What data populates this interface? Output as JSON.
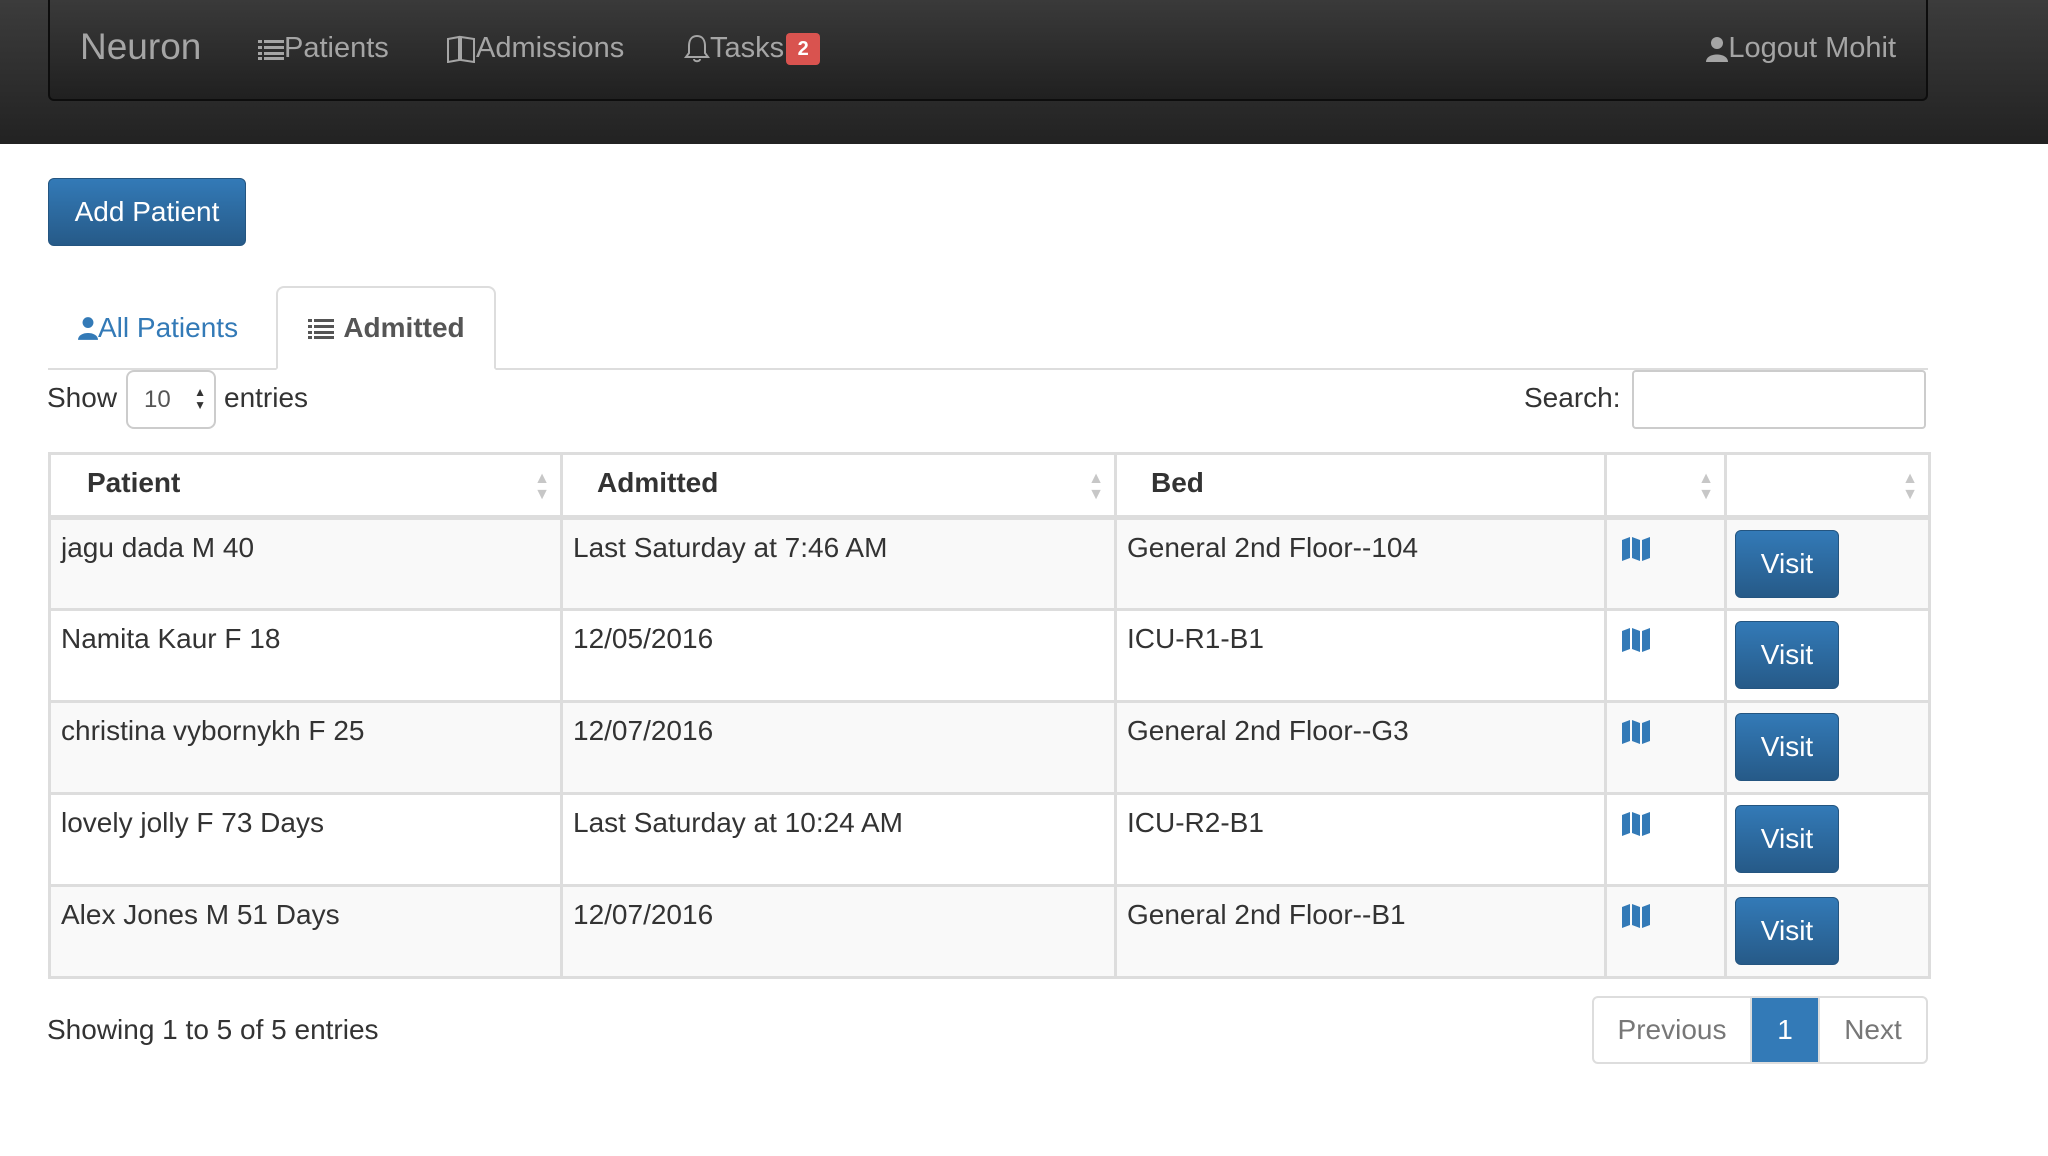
{
  "navbar": {
    "brand": "Neuron",
    "patients": "Patients",
    "admissions": "Admissions",
    "tasks": "Tasks",
    "tasks_badge": "2",
    "logout": "Logout Mohit"
  },
  "toolbar": {
    "add_patient": "Add Patient"
  },
  "tabs": {
    "all_patients": "All Patients",
    "admitted": "Admitted"
  },
  "length": {
    "show": "Show",
    "value": "10",
    "entries": "entries"
  },
  "search": {
    "label": "Search:",
    "value": ""
  },
  "table": {
    "headers": [
      "Patient",
      "Admitted",
      "Bed",
      "",
      ""
    ],
    "rows": [
      {
        "patient": "jagu dada M 40",
        "admitted": "Last Saturday at 7:46 AM",
        "bed": "General 2nd Floor--104",
        "action": "Visit"
      },
      {
        "patient": "Namita Kaur F 18",
        "admitted": "12/05/2016",
        "bed": "ICU-R1-B1",
        "action": "Visit"
      },
      {
        "patient": "christina vybornykh F 25",
        "admitted": "12/07/2016",
        "bed": "General 2nd Floor--G3",
        "action": "Visit"
      },
      {
        "patient": "lovely jolly F 73 Days",
        "admitted": "Last Saturday at 10:24 AM",
        "bed": "ICU-R2-B1",
        "action": "Visit"
      },
      {
        "patient": "Alex Jones M 51 Days",
        "admitted": "12/07/2016",
        "bed": "General 2nd Floor--B1",
        "action": "Visit"
      }
    ]
  },
  "footer": {
    "info": "Showing 1 to 5 of 5 entries",
    "previous": "Previous",
    "current_page": "1",
    "next": "Next"
  },
  "icons": {
    "patients": "list-icon",
    "admissions": "book-icon",
    "tasks": "bell-icon",
    "logout": "user-icon",
    "all_patients": "user-icon",
    "admitted": "list-icon",
    "bed_map": "map-icon"
  },
  "colors": {
    "primary": "#337ab7",
    "badge": "#d9534f",
    "navbar": "#222222"
  }
}
